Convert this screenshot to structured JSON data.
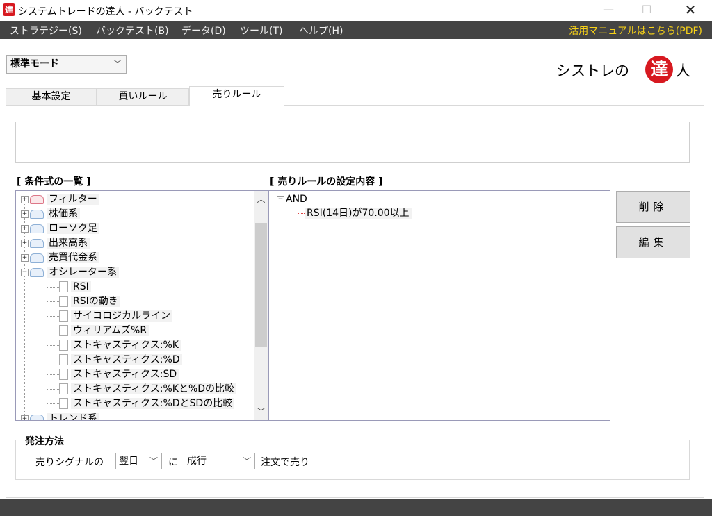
{
  "window": {
    "title": "システムトレードの達人 - バックテスト",
    "icon_glyph": "達",
    "minimize": "—",
    "maximize": "☐",
    "close": "✕"
  },
  "menu": {
    "items": [
      "ストラテジー(S)",
      "バックテスト(B)",
      "データ(D)",
      "ツール(T)",
      "ヘルプ(H)"
    ],
    "manual_link": "活用マニュアルはこちら(PDF)"
  },
  "mode_select": {
    "value": "標準モード"
  },
  "logo": {
    "text": "シストレの",
    "seal": "達",
    "tail": "人"
  },
  "tabs": [
    "基本設定",
    "買いルール",
    "売りルール"
  ],
  "active_tab": "売りルール",
  "conditions": {
    "label": "[ 条件式の一覧 ]",
    "categories": [
      "フィルター",
      "株価系",
      "ローソク足",
      "出来高系",
      "売買代金系",
      "オシレーター系"
    ],
    "oscillator_items": [
      "RSI",
      "RSIの動き",
      "サイコロジカルライン",
      "ウィリアムズ%R",
      "ストキャスティクス:%K",
      "ストキャスティクス:%D",
      "ストキャスティクス:SD",
      "ストキャスティクス:%Kと%Dの比較",
      "ストキャスティクス:%DとSDの比較"
    ],
    "partial_next": "トレンド系"
  },
  "rule": {
    "label": "[ 売りルールの設定内容 ]",
    "root": "AND",
    "child": "RSI(14日)が70.00以上"
  },
  "buttons": {
    "delete": "削除",
    "edit": "編集"
  },
  "order": {
    "label": "発注方法",
    "prefix": "売りシグナルの",
    "timing": "翌日",
    "mid": "に",
    "type": "成行",
    "suffix": "注文で売り"
  },
  "colors": {
    "menubar": "#444444",
    "link": "#f7d117",
    "brand_red": "#d71920"
  }
}
